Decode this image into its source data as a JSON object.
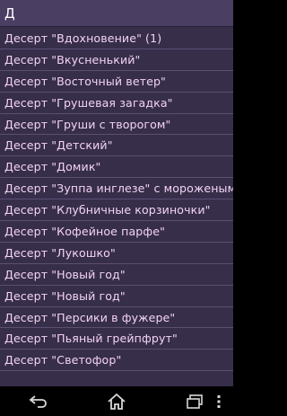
{
  "header": {
    "title": "Д"
  },
  "items": [
    "Десерт \"Вдохновение\" (1)",
    "Десерт \"Вкусненький\"",
    "Десерт \"Восточный ветер\"",
    "Десерт \"Грушевая загадка\"",
    "Десерт \"Груши с творогом\"",
    "Десерт \"Детский\"",
    "Десерт \"Домик\"",
    "Десерт \"Зуппа инглезе\" с мороженым и",
    "Десерт \"Клубничные корзиночки\"",
    "Десерт \"Кофейное парфе\"",
    "Десерт \"Лукошко\"",
    "Десерт \"Новый год\"",
    "Десерт \"Новый год\"",
    "Десерт \"Персики в фужере\"",
    "Десерт \"Пьяный грейпфрут\"",
    "Десерт \"Светофор\""
  ],
  "navbar": {
    "back": "back-icon",
    "home": "home-icon",
    "recents": "recents-icon",
    "menu": "overflow-menu-icon"
  },
  "colors": {
    "background": "#372e49",
    "item_text": "#f3d3f6",
    "divider": "#5b4f72"
  }
}
